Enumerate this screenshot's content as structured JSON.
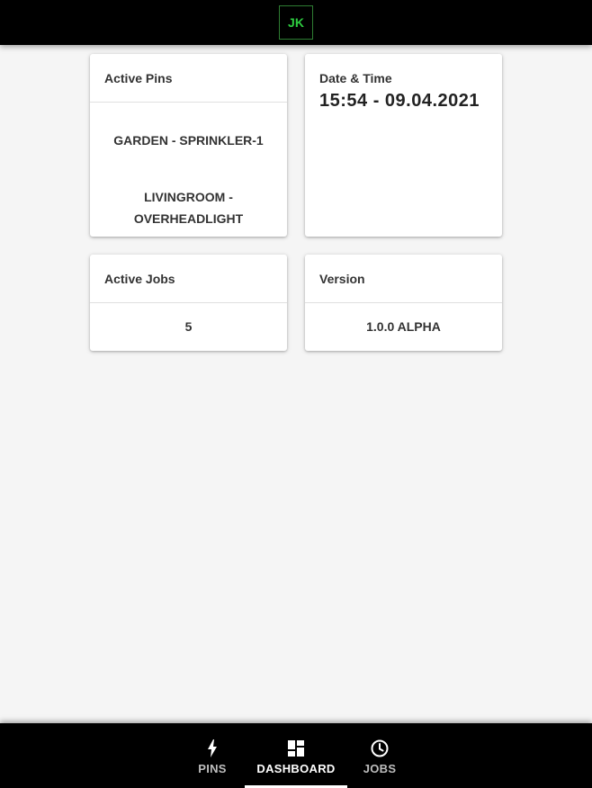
{
  "header": {
    "logo_text": "JK",
    "logo_color": "#2ecc40"
  },
  "cards": {
    "active_pins": {
      "title": "Active Pins",
      "items": [
        "GARDEN - SPRINKLER-1",
        "LIVINGROOM - OVERHEADLIGHT"
      ]
    },
    "datetime": {
      "title": "Date & Time",
      "value": "15:54 - 09.04.2021"
    },
    "active_jobs": {
      "title": "Active Jobs",
      "value": "5"
    },
    "version": {
      "title": "Version",
      "value": "1.0.0 ALPHA"
    }
  },
  "bottom_nav": {
    "items": [
      {
        "label": "PINS",
        "icon": "bolt-icon"
      },
      {
        "label": "DASHBOARD",
        "icon": "dashboard-icon",
        "active": true
      },
      {
        "label": "JOBS",
        "icon": "clock-icon"
      }
    ]
  }
}
